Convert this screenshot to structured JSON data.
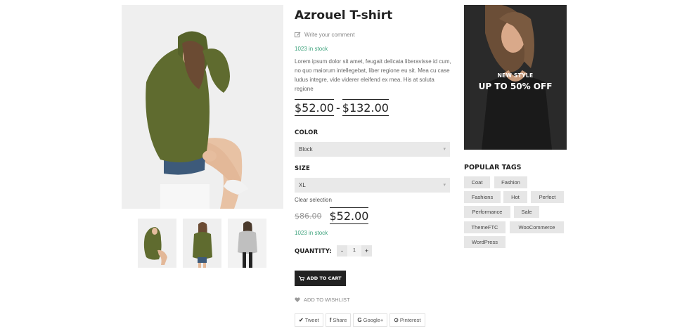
{
  "product": {
    "title": "Azrouel T-shirt",
    "write_comment": "Write your comment",
    "stock_top": "1023 in stock",
    "description": "Lorem ipsum dolor sit amet, feugait delicata liberavisse id cum, no quo maiorum intellegebat, liber regione eu sit. Mea cu case ludus integre, vide viderer eleifend ex mea. His at soluta regione",
    "price_min": "$52.00",
    "price_sep": "-",
    "price_max": "$132.00",
    "color_label": "COLOR",
    "color_value": "Block",
    "size_label": "SIZE",
    "size_value": "XL",
    "clear_selection": "Clear selection",
    "old_price": "$86.00",
    "new_price": "$52.00",
    "stock_bottom": "1023 in stock",
    "quantity_label": "QUANTITY:",
    "qty_minus": "-",
    "qty_value": "1",
    "qty_plus": "+",
    "add_to_cart": "ADD TO CART",
    "add_to_wishlist": "ADD TO WISHLIST"
  },
  "share": {
    "tweet": "Tweet",
    "share": "Share",
    "google": "Google+",
    "pinterest": "Pinterest"
  },
  "banner": {
    "subtitle": "NEW STYLE",
    "headline": "UP TO 50% OFF"
  },
  "tags": {
    "title": "POPULAR TAGS",
    "items": [
      "Coat",
      "Fashion",
      "Fashions",
      "Hot",
      "Perfect",
      "Performance",
      "Sale",
      "ThemeFTC",
      "WooCommerce",
      "WordPress"
    ]
  },
  "icons": {
    "comment": "edit-icon",
    "cart": "cart-icon",
    "wishlist": "heart-icon",
    "arrow": "chevron-down-icon"
  },
  "colors": {
    "stock_green": "#3fa37d",
    "button_dark": "#222222",
    "select_bg": "#e9e9e9",
    "tag_bg": "#e6e6e6"
  }
}
